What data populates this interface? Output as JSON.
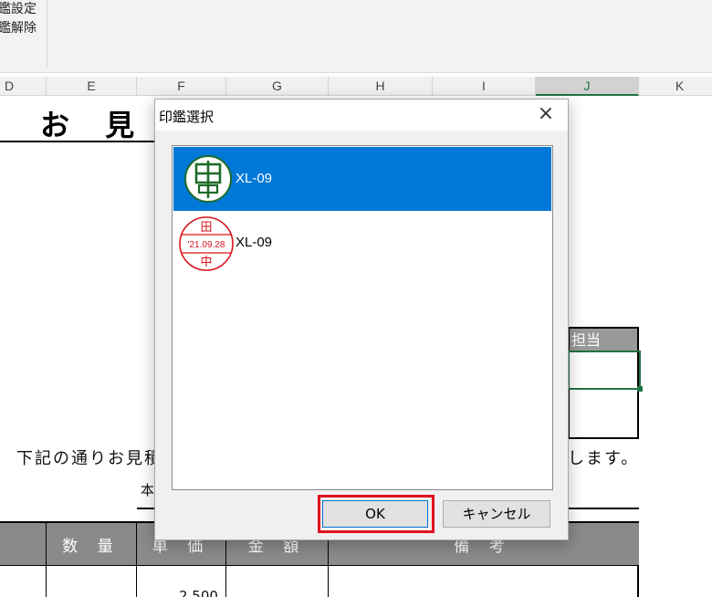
{
  "ribbon": {
    "cmd1": "鑑設定",
    "cmd2": "鑑解除"
  },
  "columns": [
    "D",
    "E",
    "F",
    "G",
    "H",
    "I",
    "J",
    "K"
  ],
  "sheet": {
    "title": "お 見",
    "body_left": "下記の通りお見積",
    "body_right": "します。",
    "honorific": "本",
    "stamp_header": "担当",
    "table_headers": [
      "数 量",
      "単 価",
      "金 額",
      "備 考"
    ],
    "partial_value": "2,500"
  },
  "dialog": {
    "title": "印鑑選択",
    "close": "×",
    "items": [
      {
        "label": "XL-09",
        "stamp": {
          "type": "round",
          "text": "田中",
          "color": "#1d6b2a"
        }
      },
      {
        "label": "XL-09",
        "stamp": {
          "type": "dated",
          "top": "田",
          "date": "'21.09.28",
          "bottom": "中",
          "color": "#d8141c"
        }
      }
    ],
    "ok_label": "OK",
    "cancel_label": "キャンセル",
    "highlight_color": "#e0121f"
  }
}
